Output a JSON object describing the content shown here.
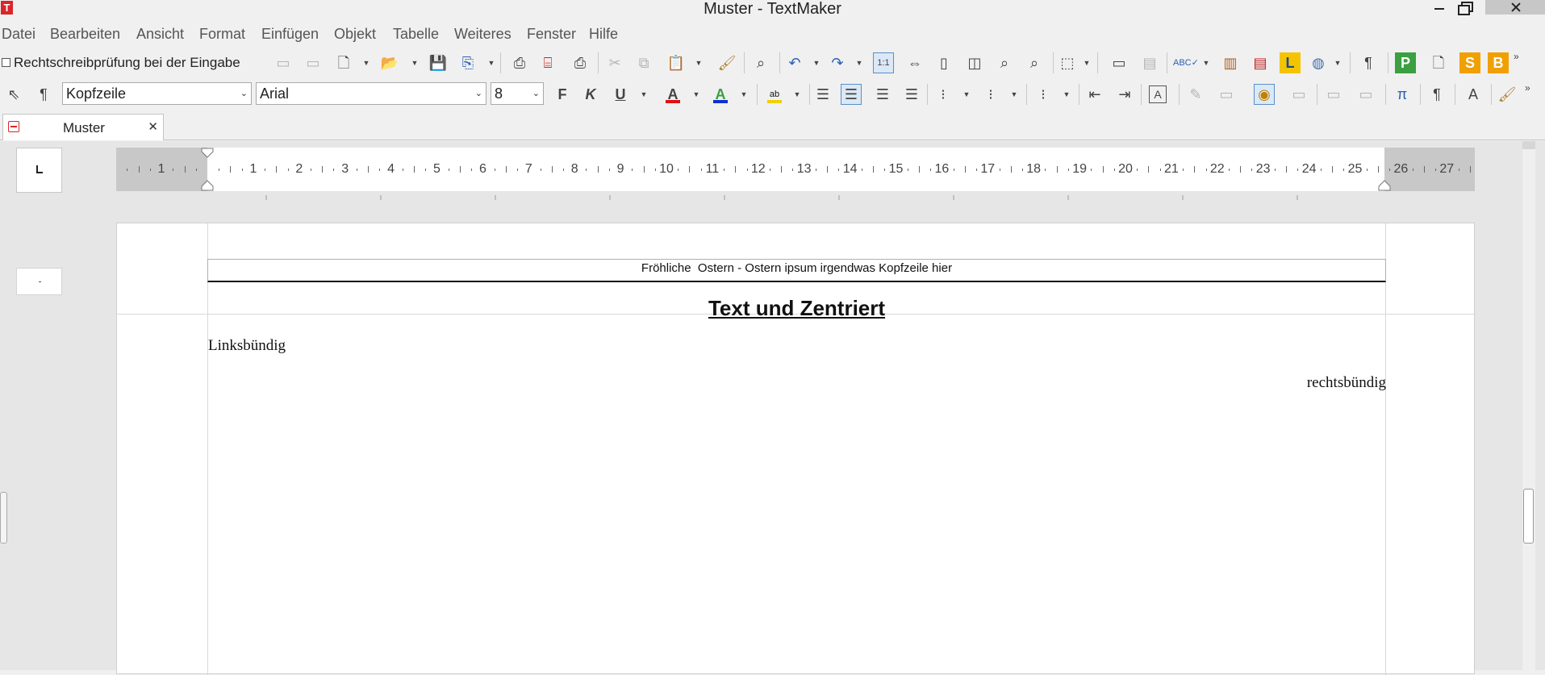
{
  "window": {
    "title": "Muster - TextMaker",
    "app_icon_glyph": "T"
  },
  "menu": [
    "Datei",
    "Bearbeiten",
    "Ansicht",
    "Format",
    "Einfügen",
    "Objekt",
    "Tabelle",
    "Weiteres",
    "Fenster",
    "Hilfe"
  ],
  "toolbar1": {
    "spellcheck_label": "Rechtschreibprüfung bei der Eingabe",
    "spellcheck_checked": false
  },
  "toolbar2": {
    "paragraph_style": "Kopfzeile",
    "font_name": "Arial",
    "font_size": "8",
    "bold_label": "F",
    "italic_label": "K",
    "underline_label": "U",
    "font_color_glyph": "A",
    "highlight_glyph": "A",
    "colors": {
      "font_color": "#e01010",
      "highlight_color": "#1030d0",
      "marker_color": "#f0d000",
      "green_button": "#3aa040",
      "orange_button": "#f0a000"
    }
  },
  "tab": {
    "label": "Muster"
  },
  "ruler": {
    "numbers": [
      "1",
      "1",
      "2",
      "3",
      "4",
      "5",
      "6",
      "7",
      "8",
      "9",
      "10",
      "11",
      "12",
      "13",
      "14",
      "15",
      "16",
      "17",
      "18",
      "19",
      "20",
      "21",
      "22",
      "23",
      "24",
      "25",
      "26",
      "27"
    ]
  },
  "document": {
    "header_text": "Fröhliche  Ostern - Ostern ipsum irgendwas Kopfzeile hier",
    "heading": "Text und Zentriert",
    "left_text": "Linksbündig",
    "right_text": "rechtsbündig"
  }
}
